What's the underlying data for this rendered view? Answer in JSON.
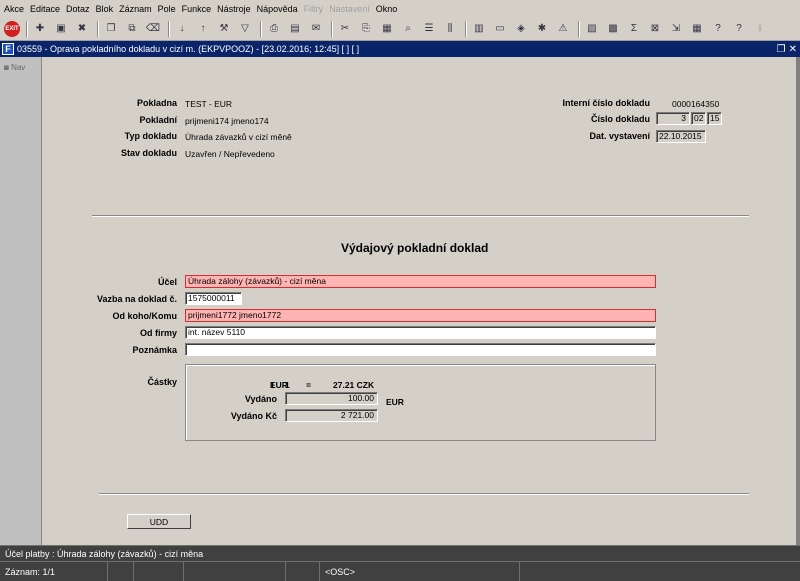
{
  "menu": [
    "Akce",
    "Editace",
    "Dotaz",
    "Blok",
    "Záznam",
    "Pole",
    "Funkce",
    "Nástroje",
    "Nápověda"
  ],
  "menu_disabled": [
    "Filtry",
    "Nastavení"
  ],
  "menu_last": "Okno",
  "toolbar": {
    "exit_label": "EXIT"
  },
  "window": {
    "title": "03559 - Oprava pokladního dokladu v cizí m. (EKPVPOOZ) - [23.02.2016; 12:45]  [ ]  [ ]",
    "icon": "F"
  },
  "nav": {
    "label": "Nav"
  },
  "header": {
    "pokladna_label": "Pokladna",
    "pokladna_value": "TEST - EUR",
    "pokladni_label": "Pokladní",
    "pokladni_value": "prijmeni174 jmeno174",
    "typ_label": "Typ dokladu",
    "typ_value": "Úhrada závazků v cizí měně",
    "stav_label": "Stav dokladu",
    "stav_value": "Uzavřen / Nepřevedeno",
    "interni_label": "Interní číslo dokladu",
    "interni_value": "0000164350",
    "cislo_label": "Číslo dokladu",
    "cislo_1": "3",
    "cislo_2": "02",
    "cislo_3": "15",
    "dat_label": "Dat. vystavení",
    "dat_value": "22.10.2015"
  },
  "form": {
    "title": "Výdajový pokladní doklad",
    "ucel_label": "Účel",
    "ucel_value": "Úhrada zálohy (závazků) - cizí měna",
    "vazba_label": "Vazba na doklad č.",
    "vazba_value": "1575000011",
    "odkoho_label": "Od koho/Komu",
    "odkoho_value": "prijmeni1772 jmeno1772",
    "odfirmy_label": "Od firmy",
    "odfirmy_value": "int. název 5110",
    "poznamka_label": "Poznámka",
    "poznamka_value": "",
    "castky_label": "Částky",
    "rate_qty": "1",
    "rate_cur": "EUR",
    "rate_eq": "=",
    "rate_val": "27.21 CZK",
    "vydano_label": "Vydáno",
    "vydano_value": "100.00",
    "vydano_cur": "EUR",
    "vydanokc_label": "Vydáno Kč",
    "vydanokc_value": "2 721.00",
    "udd_button": "UDD"
  },
  "status": {
    "message": "Účel platby : Úhrada zálohy (závazků) - cizí měna",
    "record": "Záznam: 1/1",
    "mode": "<OSC>"
  }
}
